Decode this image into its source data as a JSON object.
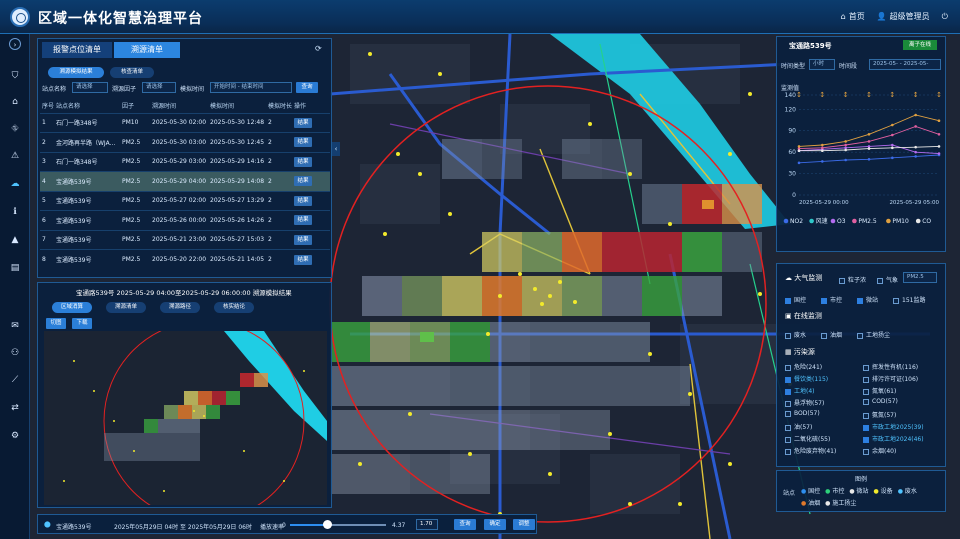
{
  "header": {
    "title": "区域一体化智慧治理平台",
    "home": "首页",
    "user": "超级管理员"
  },
  "left_panel": {
    "tabs": [
      "报警点位清单",
      "溯源清单"
    ],
    "subtabs": [
      "溯源模拟结果",
      "核查清单"
    ],
    "filters": {
      "station_label": "站点名称",
      "station_value": "请选择",
      "factor_label": "溯源因子",
      "factor_value": "请选择",
      "time_label": "模拟时间",
      "time_placeholder": "开始时间 - 结束时间",
      "query": "查询"
    },
    "columns": [
      "序号",
      "站点名称",
      "因子",
      "溯源时间",
      "模拟时间",
      "模拟时长",
      "操作"
    ],
    "rows": [
      {
        "no": "1",
        "name": "石门一路348号",
        "factor": "PM10",
        "trace": "2025-05-30 02:00",
        "sim": "2025-05-30 12:48",
        "dur": "2",
        "op": "结果"
      },
      {
        "no": "2",
        "name": "金河路再半路（WJA...",
        "factor": "PM2.5",
        "trace": "2025-05-30 03:00",
        "sim": "2025-05-30 12:45",
        "dur": "2",
        "op": "结果"
      },
      {
        "no": "3",
        "name": "石门一路348号",
        "factor": "PM2.5",
        "trace": "2025-05-29 03:00",
        "sim": "2025-05-29 14:16",
        "dur": "2",
        "op": "结果"
      },
      {
        "no": "4",
        "name": "宝通路539号",
        "factor": "PM2.5",
        "trace": "2025-05-29 04:00",
        "sim": "2025-05-29 14:08",
        "dur": "2",
        "op": "结果"
      },
      {
        "no": "5",
        "name": "宝通路539号",
        "factor": "PM2.5",
        "trace": "2025-05-27 02:00",
        "sim": "2025-05-27 13:29",
        "dur": "2",
        "op": "结果"
      },
      {
        "no": "6",
        "name": "宝通路539号",
        "factor": "PM2.5",
        "trace": "2025-05-26 00:00",
        "sim": "2025-05-26 14:26",
        "dur": "2",
        "op": "结果"
      },
      {
        "no": "7",
        "name": "宝通路539号",
        "factor": "PM2.5",
        "trace": "2025-05-21 23:00",
        "sim": "2025-05-27 15:03",
        "dur": "2",
        "op": "结果"
      },
      {
        "no": "8",
        "name": "宝通路539号",
        "factor": "PM2.5",
        "trace": "2025-05-20 22:00",
        "sim": "2025-05-21 14:05",
        "dur": "2",
        "op": "结果"
      }
    ],
    "result_title": "宝通路539号 2025-05-29 04:00至2025-05-29 06:00:00 溯源模拟结果",
    "result_tabs": [
      "区域消算",
      "溯源清单",
      "溯源路径",
      "核实结论"
    ],
    "result_buttons": [
      "切图",
      "下载"
    ]
  },
  "right_panel": {
    "station": "宝通路539号",
    "badge": "离子在线",
    "time_type_label": "时间类型",
    "time_type": "小时",
    "time_range_label": "时间段",
    "time_range": "2025-05- - 2025-05-",
    "monitor_label": "监测值",
    "chart_data": {
      "type": "line",
      "x_labels": [
        "2025-05-29 00:00",
        "2025-05-29 05:00"
      ],
      "ylim": [
        0,
        140
      ],
      "yticks": [
        0,
        30,
        60,
        90,
        120,
        140
      ],
      "series": [
        {
          "name": "NO2",
          "color": "#3b6be8",
          "values": [
            45,
            47,
            49,
            50,
            52,
            54,
            56
          ]
        },
        {
          "name": "风速",
          "color": "#2ec7c9",
          "values": [
            null,
            null,
            null,
            null,
            null,
            null,
            null
          ]
        },
        {
          "name": "O3",
          "color": "#b46cf0",
          "values": [
            62,
            64,
            66,
            68,
            70,
            60,
            58
          ]
        },
        {
          "name": "PM2.5",
          "color": "#e05fa0",
          "values": [
            65,
            66,
            70,
            75,
            84,
            96,
            85
          ]
        },
        {
          "name": "PM10",
          "color": "#e0a040",
          "values": [
            68,
            70,
            75,
            85,
            98,
            112,
            104
          ]
        },
        {
          "name": "CO",
          "color": "#e8e8e8",
          "values": [
            62,
            62,
            63,
            65,
            66,
            67,
            68
          ]
        }
      ]
    },
    "layer_head": "大气监测",
    "layer_opts": [
      "粒子浓",
      "气象",
      "PM2.5"
    ],
    "layer_row2": [
      "国控",
      "市控",
      "微站",
      "151监路"
    ],
    "online_head": "在线监测",
    "online_items": [
      "废水",
      "油烟",
      "工地扬尘"
    ],
    "pollution_head": "污染源",
    "pollution_items": [
      [
        "危险(241)",
        "挥发性有机(116)"
      ],
      [
        "餐饮类(115)",
        "排污许可证(106)"
      ],
      [
        "工地(4)",
        "氮氧(61)"
      ],
      [
        "悬浮物(57)",
        "COD(57)"
      ],
      [
        "BOD(57)",
        "氨氮(57)"
      ],
      [
        "油(57)",
        "市政工地2025(39)"
      ],
      [
        "二氧化硫(55)",
        "市政工地2024(46)"
      ],
      [
        "危险废弃物(41)",
        "余烟(40)"
      ]
    ],
    "legend_title": "图例",
    "legend_label": "站点",
    "legend_items": [
      "国控",
      "市控",
      "微站",
      "设备",
      "废水",
      "油烟",
      "施工扬尘"
    ]
  },
  "timeline": {
    "station": "宝通路539号",
    "range": "2025年05月29日 04时 至 2025年05月29日 06时",
    "speed_label": "播放速率",
    "speed_min": "0",
    "speed_max": "4.37",
    "speed_value": "1.70",
    "buttons": [
      "查询",
      "确定",
      "调整"
    ]
  }
}
